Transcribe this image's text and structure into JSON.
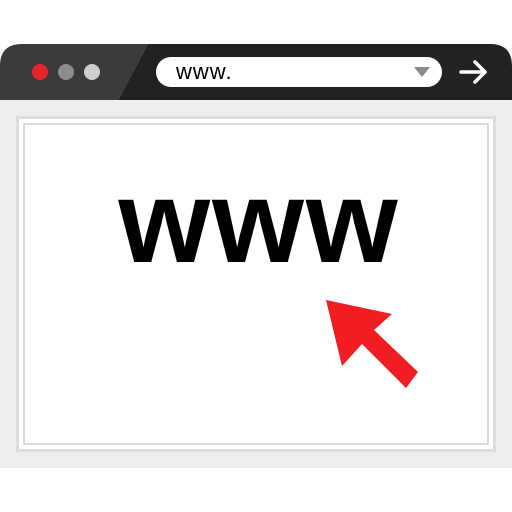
{
  "address_bar": {
    "url": "www."
  },
  "page": {
    "heading": "www"
  },
  "colors": {
    "titlebar": "#222222",
    "titlebar_accent": "#3a3a3a",
    "close_dot": "#e8222a",
    "minimize_dot": "#8c8c8c",
    "maximize_dot": "#cfcfcf",
    "cursor": "#f21d22"
  },
  "icons": {
    "go": "arrow-right-icon",
    "dropdown": "triangle-down-icon",
    "cursor": "pointer-arrow-icon"
  }
}
